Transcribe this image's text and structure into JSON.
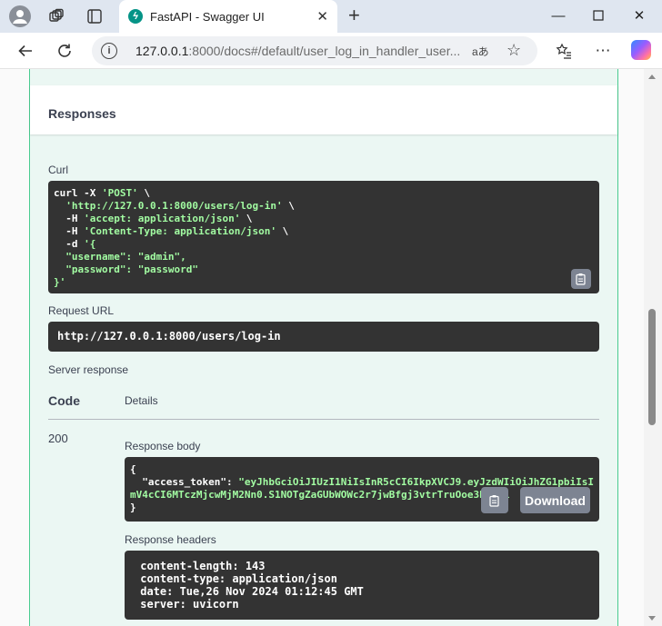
{
  "browser": {
    "tab_title": "FastAPI - Swagger UI",
    "url_host": "127.0.0.1",
    "url_rest": ":8000/docs#/default/user_log_in_handler_user...",
    "read_aloud": "aあ"
  },
  "responses": {
    "title": "Responses"
  },
  "curl": {
    "label": "Curl",
    "lines": [
      [
        "curl -X ",
        "'POST'",
        " \\"
      ],
      [
        "  ",
        "'http://127.0.0.1:8000/users/log-in'",
        " \\"
      ],
      [
        "  -H ",
        "'accept: application/json'",
        " \\"
      ],
      [
        "  -H ",
        "'Content-Type: application/json'",
        " \\"
      ],
      [
        "  -d ",
        "'{",
        ""
      ],
      [
        "  ",
        "\"username\": \"admin\",",
        ""
      ],
      [
        "  ",
        "\"password\": \"password\"",
        ""
      ],
      [
        "",
        "}'",
        ""
      ]
    ]
  },
  "request_url": {
    "label": "Request URL",
    "value": "http://127.0.0.1:8000/users/log-in"
  },
  "server_response": {
    "label": "Server response",
    "code_header": "Code",
    "details_header": "Details",
    "code": "200",
    "body_label": "Response body",
    "body_lines": [
      "{",
      "  \"access_token\": \"eyJhbGciOiJIUzI1NiIsInR5cCI6IkpXVCJ9.eyJzdWIiOiJhZG1pbiIsI",
      "mV4cCI6MTczMjcwMjM2Nn0.S1NOTgZaGUbWOWc2r7jwBfgj3vtrTruOoe3bdaPi",
      "}"
    ],
    "download_label": "Download",
    "headers_label": "Response headers",
    "headers_lines": [
      " content-length: 143 ",
      " content-type: application/json ",
      " date: Tue,26 Nov 2024 01:12:45 GMT ",
      " server: uvicorn "
    ]
  },
  "colors": {
    "accent": "#49cc90",
    "code_bg": "#333333",
    "string": "#a2fca2"
  }
}
